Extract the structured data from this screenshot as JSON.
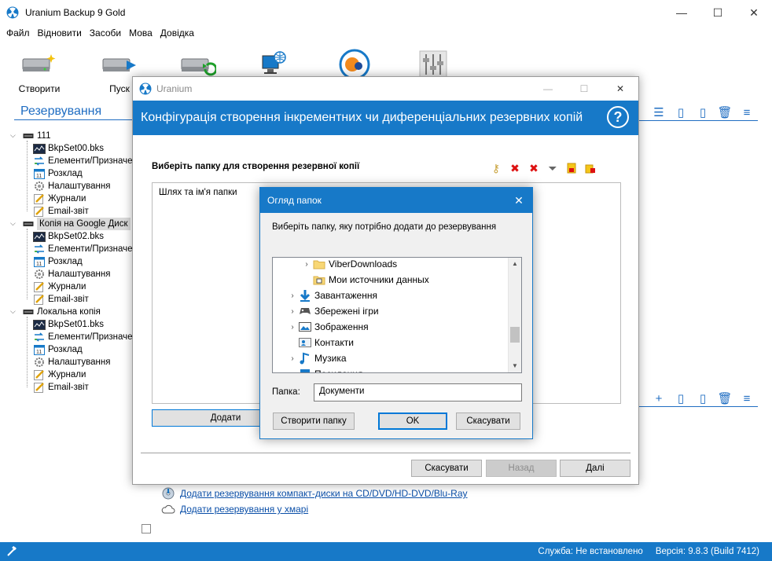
{
  "app": {
    "title": "Uranium Backup 9 Gold",
    "window_controls": {
      "minimize": "—",
      "maximize": "☐",
      "close": "✕"
    }
  },
  "menu": [
    "Файл",
    "Відновити",
    "Засоби",
    "Мова",
    "Довідка"
  ],
  "toolbar": {
    "items": [
      {
        "label": "Створити",
        "icon": "create-backup-icon"
      },
      {
        "label": "Пуск",
        "icon": "run-backup-icon"
      },
      {
        "label": "",
        "icon": "restore-icon"
      },
      {
        "label": "",
        "icon": "network-icon"
      },
      {
        "label": "",
        "icon": "uranium-logo-icon"
      },
      {
        "label": "",
        "icon": "settings-sliders-icon"
      }
    ]
  },
  "left_panel": {
    "title": "Резервування",
    "tree": [
      {
        "label": "111",
        "level": 0,
        "icon": "drive-icon",
        "selected": false
      },
      {
        "label": "BkpSet00.bks",
        "level": 1,
        "icon": "backup-set-icon"
      },
      {
        "label": "Елементи/Призначе",
        "level": 1,
        "icon": "items-icon"
      },
      {
        "label": "Розклад",
        "level": 1,
        "icon": "calendar-icon"
      },
      {
        "label": "Налаштування",
        "level": 1,
        "icon": "settings-icon"
      },
      {
        "label": "Журнали",
        "level": 1,
        "icon": "log-icon"
      },
      {
        "label": "Email-звіт",
        "level": 1,
        "icon": "email-icon"
      },
      {
        "label": "Копія на Google Диск",
        "level": 0,
        "icon": "drive-icon",
        "selected": true
      },
      {
        "label": "BkpSet02.bks",
        "level": 1,
        "icon": "backup-set-icon"
      },
      {
        "label": "Елементи/Призначе",
        "level": 1,
        "icon": "items-icon"
      },
      {
        "label": "Розклад",
        "level": 1,
        "icon": "calendar-icon"
      },
      {
        "label": "Налаштування",
        "level": 1,
        "icon": "settings-icon"
      },
      {
        "label": "Журнали",
        "level": 1,
        "icon": "log-icon"
      },
      {
        "label": "Email-звіт",
        "level": 1,
        "icon": "email-icon"
      },
      {
        "label": "Локальна копія",
        "level": 0,
        "icon": "drive-icon",
        "selected": false
      },
      {
        "label": "BkpSet01.bks",
        "level": 1,
        "icon": "backup-set-icon"
      },
      {
        "label": "Елементи/Призначе",
        "level": 1,
        "icon": "items-icon"
      },
      {
        "label": "Розклад",
        "level": 1,
        "icon": "calendar-icon"
      },
      {
        "label": "Налаштування",
        "level": 1,
        "icon": "settings-icon"
      },
      {
        "label": "Журнали",
        "level": 1,
        "icon": "log-icon"
      },
      {
        "label": "Email-звіт",
        "level": 1,
        "icon": "email-icon"
      }
    ]
  },
  "right_panel": {
    "links": [
      {
        "label": "Додати резервування компакт-диски на CD/DVD/HD-DVD/Blu-Ray",
        "icon": "disc-icon"
      },
      {
        "label": "Додати резервування у хмарі",
        "icon": "cloud-icon"
      }
    ]
  },
  "wizard": {
    "window_title": "Uranium",
    "header": "Конфігурація створення інкрементних чи диференціальних резервних копій",
    "help": "?",
    "folder_label": "Виберіть папку для створення резервної копії",
    "list_header": "Шлях та ім'я папки",
    "add_button": "Додати",
    "cancel_button": "Скасувати",
    "back_button": "Назад",
    "next_button": "Далі"
  },
  "browse": {
    "title": "Огляд папок",
    "description": "Виберіть папку, яку потрібно додати до резервування",
    "tree": [
      {
        "label": "ViberDownloads",
        "icon": "folder-icon",
        "indent": 2,
        "chevron": true
      },
      {
        "label": "Мои источники данных",
        "icon": "data-sources-folder-icon",
        "indent": 2,
        "chevron": false
      },
      {
        "label": "Завантаження",
        "icon": "downloads-icon",
        "indent": 1,
        "chevron": true
      },
      {
        "label": "Збережені ігри",
        "icon": "saved-games-icon",
        "indent": 1,
        "chevron": true
      },
      {
        "label": "Зображення",
        "icon": "pictures-icon",
        "indent": 1,
        "chevron": true
      },
      {
        "label": "Контакти",
        "icon": "contacts-icon",
        "indent": 1,
        "chevron": false
      },
      {
        "label": "Музика",
        "icon": "music-icon",
        "indent": 1,
        "chevron": true
      },
      {
        "label": "Посилання",
        "icon": "links-icon",
        "indent": 1,
        "chevron": false
      }
    ],
    "folder_field_label": "Папка:",
    "folder_value": "Документи",
    "create_folder_button": "Створити папку",
    "ok_button": "OK",
    "cancel_button": "Скасувати"
  },
  "status": {
    "service": "Служба: Не встановлено",
    "version": "Версія: 9.8.3 (Build 7412)"
  }
}
